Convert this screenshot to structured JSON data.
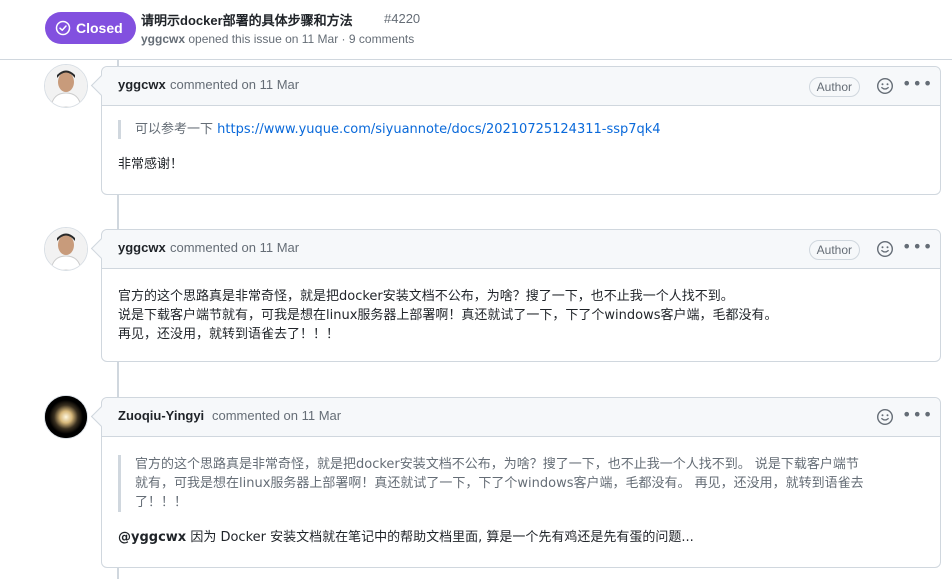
{
  "issue": {
    "state": "Closed",
    "title": "请明示docker部署的具体步骤和方法",
    "number": "#4220",
    "meta_author": "yggcwx",
    "meta_rest": " opened this issue on 11 Mar · 9 comments"
  },
  "colors": {
    "closed_purple": "#8250df",
    "link_blue": "#0969da",
    "border": "#d0d7de",
    "header_bg": "#f6f8fa"
  },
  "comments": [
    {
      "author": "yggcwx",
      "time": "commented on 11 Mar",
      "badge": "Author",
      "quote_prefix": "可以参考一下 ",
      "quote_link": "https://www.yuque.com/siyuannote/docs/20210725124311-ssp7qk4",
      "body_lines": [
        "非常感谢！"
      ]
    },
    {
      "author": "yggcwx",
      "time": "commented on 11 Mar",
      "badge": "Author",
      "body_lines": [
        "官方的这个思路真是非常奇怪，就是把docker安装文档不公布，为啥？搜了一下，也不止我一个人找不到。",
        "说是下载客户端节就有，可我是想在linux服务器上部署啊！真还就试了一下，下了个windows客户端，毛都没有。",
        "再见，还没用，就转到语雀去了！！！"
      ]
    },
    {
      "author": "Zuoqiu-Yingyi",
      "time": "commented on 11 Mar",
      "quote_lines": [
        "官方的这个思路真是非常奇怪，就是把docker安装文档不公布，为啥？搜了一下，也不止我一个人找不到。 说是下载客户端节",
        "就有，可我是想在linux服务器上部署啊！真还就试了一下，下了个windows客户端，毛都没有。 再见，还没用，就转到语雀去",
        "了！！！"
      ],
      "mention": "@yggcwx",
      "reply": " 因为 Docker 安装文档就在笔记中的帮助文档里面, 算是一个先有鸡还是先有蛋的问题..."
    }
  ],
  "icons": {
    "state": "check-circle-icon",
    "emoji": "smiley-icon",
    "more": "kebab-horizontal-icon"
  }
}
